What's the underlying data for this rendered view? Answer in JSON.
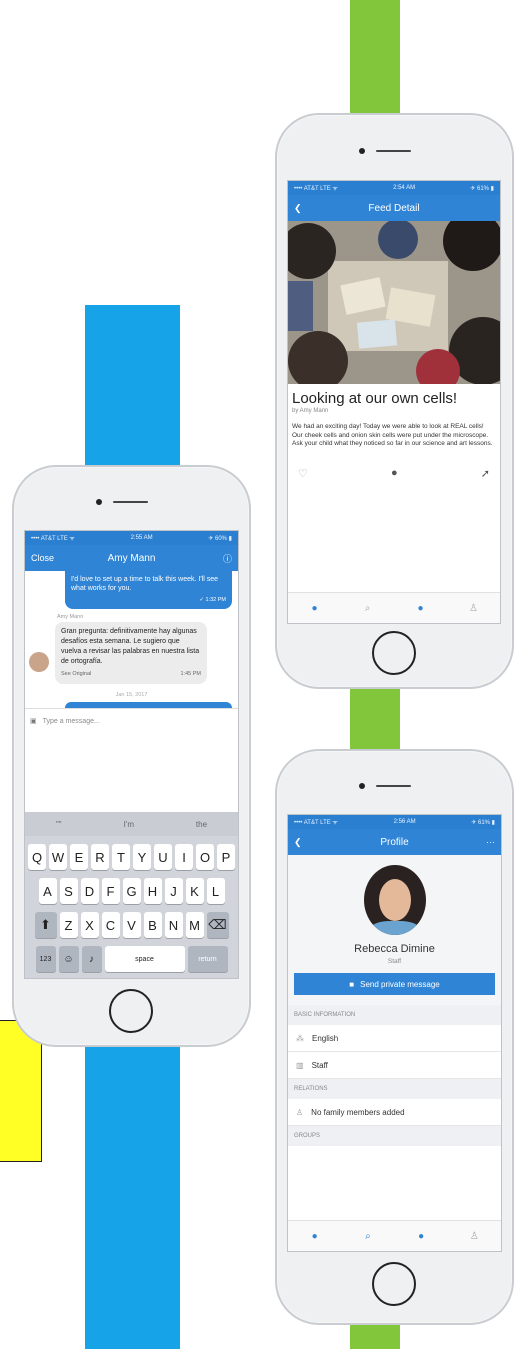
{
  "feed": {
    "status_left": "•••• AT&T LTE ᯤ",
    "status_time": "2:54 AM",
    "status_right": "✈ 61% ▮",
    "nav_title": "Feed Detail",
    "post_title": "Looking at our own cells!",
    "post_author": "by Amy Mann",
    "post_body": "We had an exciting day! Today we were able to look at REAL cells! Our cheek cells and onion skin cells were put under the microscope. Ask your child what they noticed so far in our science and art lessons."
  },
  "chat": {
    "status_left": "•••• AT&T LTE ᯤ",
    "status_time": "2:55 AM",
    "status_right": "✈ 60% ▮",
    "close_label": "Close",
    "nav_title": "Amy Mann",
    "outgoing_text": "I'd love to set up a time to talk this week. I'll see what works for you.",
    "outgoing_time": "✓ 1:32 PM",
    "sender_name": "Amy Mann",
    "incoming_text": "Gran pregunta: definitivamente hay algunas desafíos esta semana. Le sugiero que vuelva a revisar las palabras en nuestra lista de ortografía.",
    "see_original": "See Original",
    "incoming_time": "1:45 PM",
    "date_divider": "Jan 15, 2017",
    "input_placeholder": "Type a message...",
    "suggestions": [
      "\"\"",
      "I'm",
      "the"
    ],
    "keys_row1": [
      "Q",
      "W",
      "E",
      "R",
      "T",
      "Y",
      "U",
      "I",
      "O",
      "P"
    ],
    "keys_row2": [
      "A",
      "S",
      "D",
      "F",
      "G",
      "H",
      "J",
      "K",
      "L"
    ],
    "keys_row3": [
      "Z",
      "X",
      "C",
      "V",
      "B",
      "N",
      "M"
    ],
    "key_123": "123",
    "key_space": "space",
    "key_return": "return"
  },
  "profile": {
    "status_left": "•••• AT&T LTE ᯤ",
    "status_time": "2:56 AM",
    "status_right": "✈ 61% ▮",
    "nav_title": "Profile",
    "nav_more": "···",
    "name": "Rebecca Dimine",
    "role": "Staff",
    "message_button": "Send private message",
    "basic_info_header": "BASIC INFORMATION",
    "language": "English",
    "staff_label": "Staff",
    "relations_header": "RELATIONS",
    "no_family": "No family members added",
    "groups_header": "GROUPS"
  }
}
